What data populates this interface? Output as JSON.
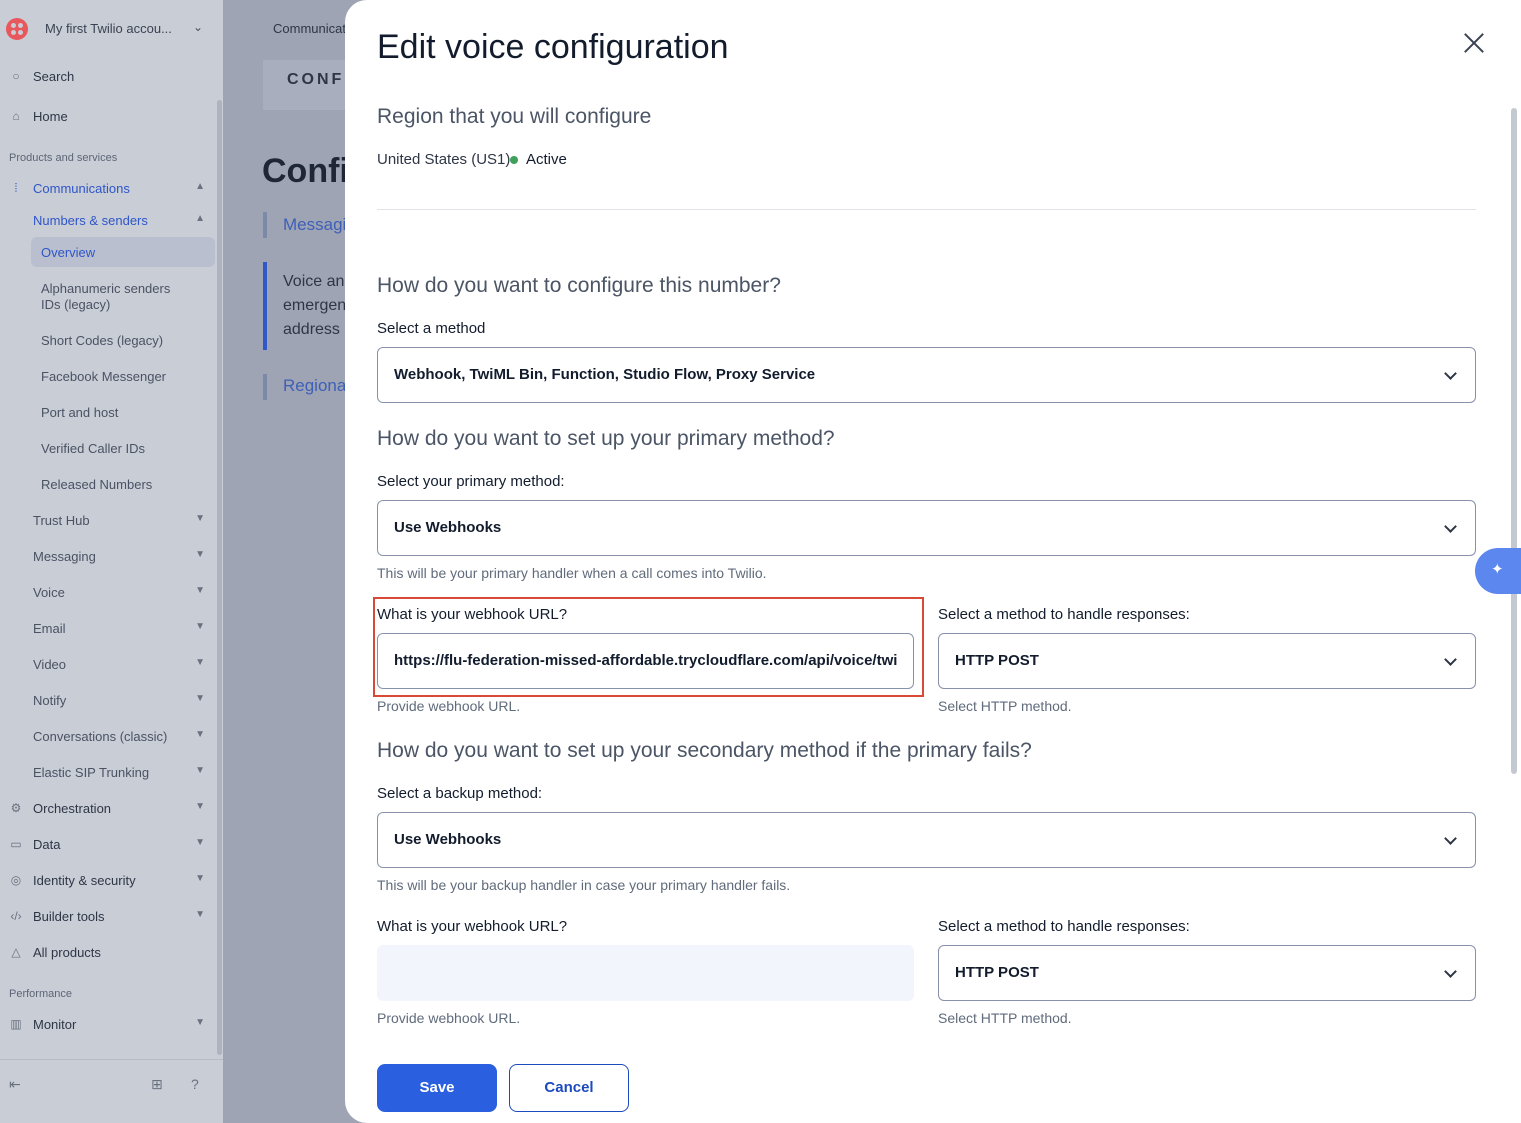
{
  "sidebar": {
    "account_name": "My first Twilio accou...",
    "search": "Search",
    "home": "Home",
    "section_products": "Products and services",
    "communications": "Communications",
    "numbers_senders": "Numbers & senders",
    "sub_items": [
      "Overview",
      "Alphanumeric senders",
      "IDs (legacy)",
      "Short Codes (legacy)",
      "Facebook Messenger",
      "Port and host",
      "Verified Caller IDs",
      "Released Numbers"
    ],
    "nav_items": [
      "Trust Hub",
      "Messaging",
      "Voice",
      "Email",
      "Video",
      "Notify",
      "Conversations (classic)",
      "Elastic SIP Trunking"
    ],
    "top_items": [
      "Orchestration",
      "Data",
      "Identity & security",
      "Builder tools",
      "All products"
    ],
    "section_performance": "Performance",
    "monitor": "Monitor"
  },
  "background": {
    "breadcrumb": "Communicat",
    "tab": "CONFI",
    "heading": "Confi",
    "link_messaging": "Messagi",
    "text_lines": [
      "Voice an",
      "emergen",
      "address"
    ],
    "link_regional": "Regiona"
  },
  "modal": {
    "title": "Edit voice configuration",
    "region_heading": "Region that you will configure",
    "region_name": "United States (US1)",
    "region_status": "Active",
    "configure_heading": "How do you want to configure this number?",
    "method_label": "Select a method",
    "method_value": "Webhook, TwiML Bin, Function, Studio Flow, Proxy Service",
    "primary_heading": "How do you want to set up your primary method?",
    "primary_label": "Select your primary method:",
    "primary_value": "Use Webhooks",
    "primary_help": "This will be your primary handler when a call comes into Twilio.",
    "webhook_label": "What is your webhook URL?",
    "webhook_value": "https://flu-federation-missed-affordable.trycloudflare.com/api/voice/twi",
    "webhook_help": "Provide webhook URL.",
    "response_label": "Select a method to handle responses:",
    "response_value": "HTTP POST",
    "response_help": "Select HTTP method.",
    "secondary_heading": "How do you want to set up your secondary method if the primary fails?",
    "backup_label": "Select a backup method:",
    "backup_value": "Use Webhooks",
    "backup_help": "This will be your backup handler in case your primary handler fails.",
    "backup_webhook_label": "What is your webhook URL?",
    "backup_webhook_value": "",
    "backup_webhook_help": "Provide webhook URL.",
    "backup_response_label": "Select a method to handle responses:",
    "backup_response_value": "HTTP POST",
    "backup_response_help": "Select HTTP method.",
    "save": "Save",
    "cancel": "Cancel"
  },
  "colors": {
    "accent": "#2a5fe0",
    "highlight": "#d84a35",
    "status_active": "#3ea05a"
  }
}
